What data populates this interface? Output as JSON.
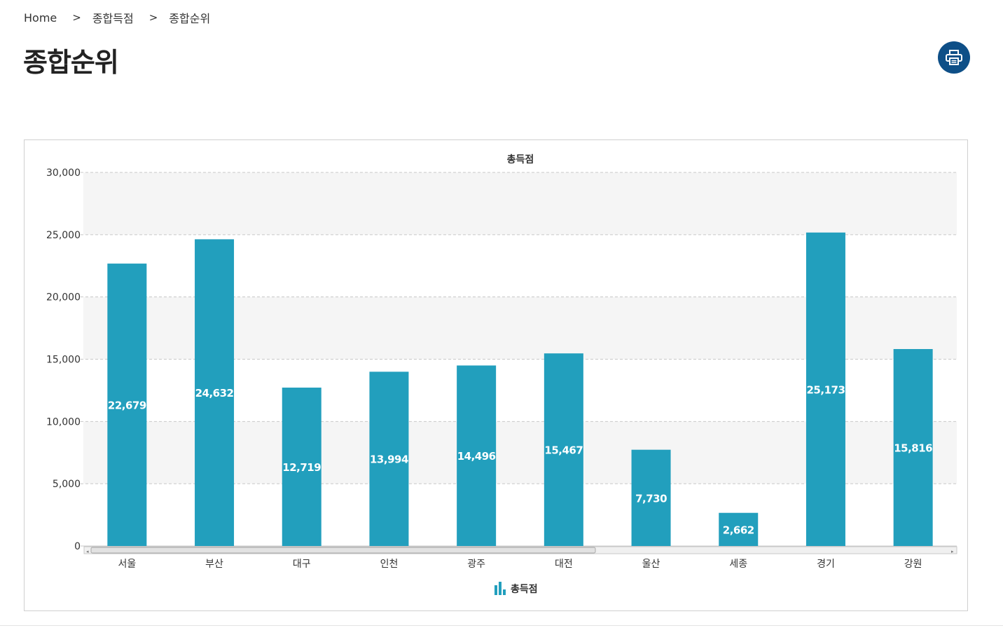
{
  "breadcrumb": {
    "items": [
      "Home",
      "종합득점",
      "종합순위"
    ],
    "separator": ">"
  },
  "page": {
    "title": "종합순위"
  },
  "icons": {
    "print": "printer-icon",
    "legend": "bar-chart-icon"
  },
  "colors": {
    "bar": "#229fbd",
    "print_button": "#0e4f87",
    "band": "#f5f5f5"
  },
  "chart_data": {
    "type": "bar",
    "title": "총득점",
    "categories": [
      "서울",
      "부산",
      "대구",
      "인천",
      "광주",
      "대전",
      "울산",
      "세종",
      "경기",
      "강원"
    ],
    "series": [
      {
        "name": "총득점",
        "values": [
          22679,
          24632,
          12719,
          13994,
          14496,
          15467,
          7730,
          2662,
          25173,
          15816
        ]
      }
    ],
    "value_labels": [
      "22,679",
      "24,632",
      "12,719",
      "13,994",
      "14,496",
      "15,467",
      "7,730",
      "2,662",
      "25,173",
      "15,816"
    ],
    "ylim": [
      0,
      30000
    ],
    "yticks": [
      0,
      5000,
      10000,
      15000,
      20000,
      25000,
      30000
    ],
    "ytick_labels": [
      "0",
      "5,000",
      "10,000",
      "15,000",
      "20,000",
      "25,000",
      "30,000"
    ],
    "grid": true,
    "legend": "bottom-center"
  }
}
